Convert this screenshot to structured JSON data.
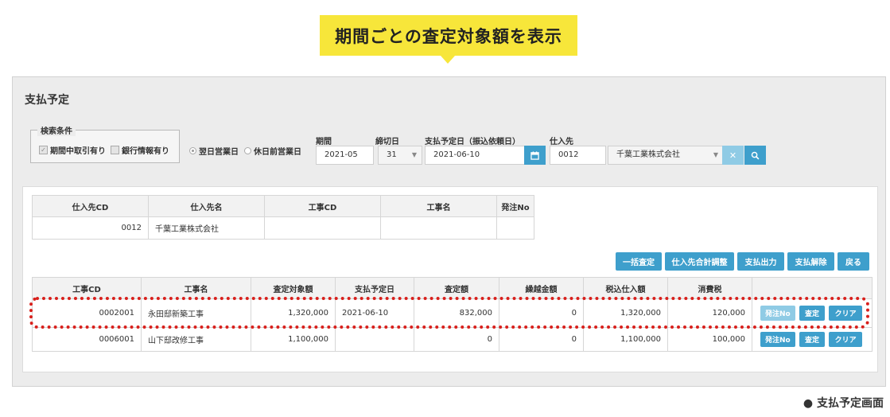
{
  "callout": {
    "text": "期間ごとの査定対象額を表示"
  },
  "page": {
    "title": "支払予定"
  },
  "search_conditions": {
    "legend": "検索条件",
    "checkbox_1": "期間中取引有り",
    "checkbox_2": "銀行情報有り"
  },
  "radio": {
    "option_1": "翌日営業日",
    "option_2": "休日前営業日"
  },
  "filters": {
    "period_label": "期間",
    "period_value": "2021-05",
    "closing_label": "締切日",
    "closing_value": "31",
    "payment_date_label": "支払予定日（振込依頼日）",
    "payment_date_value": "2021-06-10",
    "supplier_label": "仕入先",
    "supplier_code": "0012",
    "supplier_name": "千葉工業株式会社"
  },
  "supplier_table": {
    "headers": [
      "仕入先CD",
      "仕入先名",
      "工事CD",
      "工事名",
      "発注No"
    ],
    "row": [
      "0012",
      "千葉工業株式会社",
      "",
      "",
      ""
    ]
  },
  "actions": [
    "一括査定",
    "仕入先合計調整",
    "支払出力",
    "支払解除",
    "戻る"
  ],
  "detail_table": {
    "headers": [
      "工事CD",
      "工事名",
      "査定対象額",
      "支払予定日",
      "査定額",
      "繰越金額",
      "税込仕入額",
      "消費税",
      ""
    ],
    "rows": [
      [
        "0002001",
        "永田邸新築工事",
        "1,320,000",
        "2021-06-10",
        "832,000",
        "0",
        "1,320,000",
        "120,000"
      ],
      [
        "0006001",
        "山下邸改修工事",
        "1,100,000",
        "",
        "0",
        "0",
        "1,100,000",
        "100,000"
      ]
    ],
    "row_buttons": {
      "order": "発注No",
      "assess": "査定",
      "clear": "クリア"
    }
  },
  "caption": "● 支払予定画面",
  "colors": {
    "accent": "#3e9fcc",
    "callout": "#f7e63a",
    "highlight": "#d8201c"
  },
  "icons": {
    "calendar": "calendar-icon",
    "clear": "close-icon",
    "search": "search-icon"
  }
}
